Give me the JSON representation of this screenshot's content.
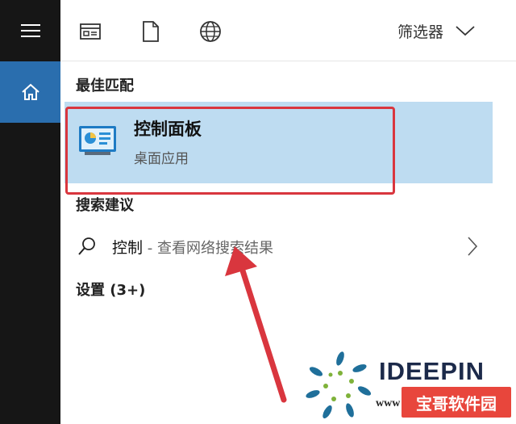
{
  "sidebar": {
    "menu_icon": "hamburger-menu-icon",
    "home_icon": "home-icon"
  },
  "topbar": {
    "icons": [
      "apps-icon",
      "documents-icon",
      "web-icon"
    ],
    "filter_label": "筛选器",
    "filter_icon": "chevron-down-icon"
  },
  "best_match": {
    "heading": "最佳匹配",
    "title": "控制面板",
    "subtitle": "桌面应用",
    "icon": "control-panel-icon"
  },
  "search_suggestions": {
    "heading": "搜索建议",
    "item": {
      "query": "控制",
      "separator": " - ",
      "description": "查看网络搜索结果",
      "icon": "search-icon",
      "arrow_icon": "chevron-right-icon"
    }
  },
  "settings": {
    "heading": "设置 (3+)"
  },
  "watermark": {
    "brand": "IDEEPIN",
    "url_prefix": "www",
    "badge": "宝哥软件园"
  },
  "colors": {
    "rail": "#161616",
    "home_active": "#2a6eae",
    "best_match_bg": "#bedcf1",
    "highlight_red": "#d9363e"
  }
}
